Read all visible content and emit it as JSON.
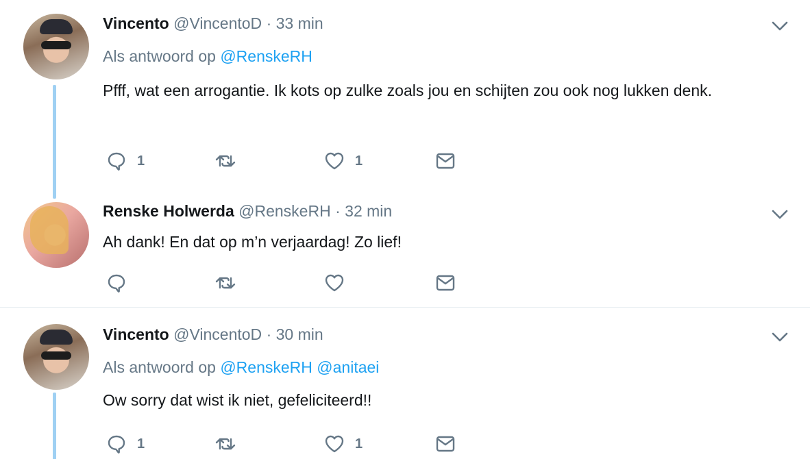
{
  "tweets": [
    {
      "name": "Vincento",
      "handle": "@VincentoD",
      "separator": "·",
      "time": "33 min",
      "reply_prefix": "Als antwoord op",
      "reply_mentions": [
        "@RenskeRH"
      ],
      "text": "Pfff, wat een arrogantie. Ik kots op zulke zoals jou en schijten zou ook nog lukken denk.",
      "reply_count": "1",
      "retweet_count": "",
      "like_count": "1"
    },
    {
      "name": "Renske Holwerda",
      "handle": "@RenskeRH",
      "separator": "·",
      "time": "32 min",
      "text": "Ah dank! En dat op m’n verjaardag! Zo lief!",
      "reply_count": "",
      "retweet_count": "",
      "like_count": ""
    },
    {
      "name": "Vincento",
      "handle": "@VincentoD",
      "separator": "·",
      "time": "30 min",
      "reply_prefix": "Als antwoord op",
      "reply_mentions": [
        "@RenskeRH",
        "@anitaei"
      ],
      "text": "Ow sorry dat wist ik niet, gefeliciteerd!!",
      "reply_count": "1",
      "retweet_count": "",
      "like_count": "1"
    }
  ],
  "icons": {
    "reply": "reply-icon",
    "retweet": "retweet-icon",
    "like": "heart-icon",
    "dm": "envelope-icon",
    "menu": "chevron-down-icon"
  },
  "colors": {
    "link": "#1da1f2",
    "muted": "#657786",
    "text": "#14171a",
    "thread_line": "#9fd0f3",
    "divider": "#e6ecf0"
  }
}
